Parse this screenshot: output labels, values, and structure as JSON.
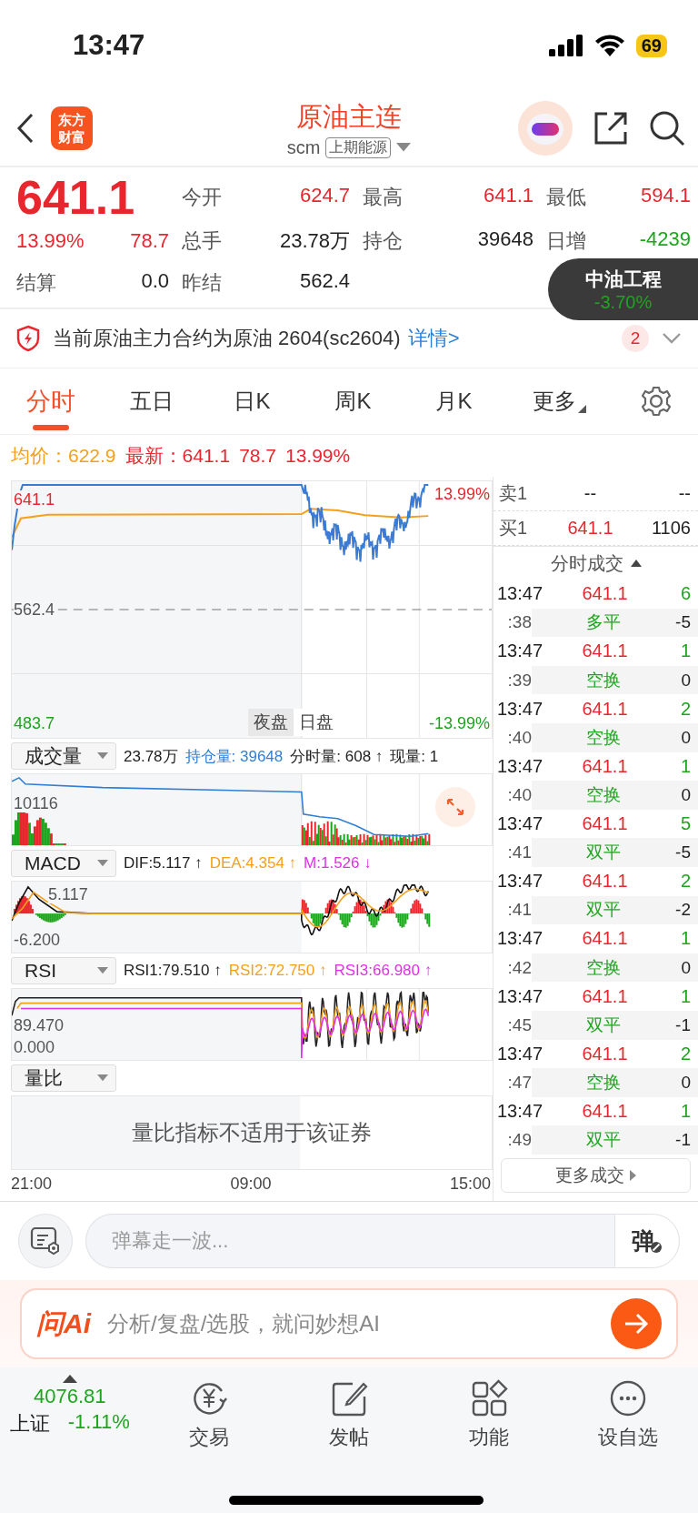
{
  "status_bar": {
    "time": "13:47",
    "battery": "69",
    "low_power": true
  },
  "header": {
    "logo_lines": [
      "东方",
      "财富"
    ],
    "title": "原油主连",
    "code": "scm",
    "exchange": "上期能源"
  },
  "quote": {
    "price": "641.1",
    "change_pct": "13.99%",
    "change": "78.7",
    "color": "#e8262d",
    "settlement": {
      "label": "结算",
      "value": "0.0"
    },
    "fields": [
      {
        "label": "今开",
        "value": "624.7",
        "color": "#e8262d"
      },
      {
        "label": "最高",
        "value": "641.1",
        "color": "#e8262d"
      },
      {
        "label": "最低",
        "value": "594.1",
        "color": "#e8262d"
      },
      {
        "label": "总手",
        "value": "23.78万",
        "color": "#222222"
      },
      {
        "label": "持仓",
        "value": "39648",
        "color": "#222222"
      },
      {
        "label": "日增",
        "value": "-4239",
        "color": "#1ea51e"
      },
      {
        "label": "昨结",
        "value": "562.4",
        "color": "#222222"
      }
    ]
  },
  "popup": {
    "name": "中油工程",
    "change": "-3.70%"
  },
  "notice": {
    "text": "当前原油主力合约为原油 2604(sc2604)",
    "link": "详情>",
    "badge": "2"
  },
  "tabs": [
    {
      "label": "分时",
      "selected": true
    },
    {
      "label": "五日",
      "selected": false
    },
    {
      "label": "日K",
      "selected": false
    },
    {
      "label": "周K",
      "selected": false
    },
    {
      "label": "月K",
      "selected": false
    },
    {
      "label": "更多",
      "selected": false
    }
  ],
  "summary": {
    "avg_label": "均价：",
    "avg": "622.9",
    "latest_label": "最新：",
    "latest": "641.1",
    "change": "78.7",
    "pct": "13.99%"
  },
  "price_chart": {
    "high": "641.1",
    "high_pct": "13.99%",
    "prev_close": "562.4",
    "low": "483.7",
    "low_pct": "-13.99%",
    "sessions": [
      {
        "label": "夜盘",
        "selected": true
      },
      {
        "label": "日盘",
        "selected": false
      }
    ]
  },
  "indicators": [
    {
      "kind": "volume",
      "name": "成交量",
      "readouts": [
        {
          "text": "23.78万",
          "color": "#222222"
        },
        {
          "text": "持仓量: 39648",
          "color": "#2f7fd6"
        },
        {
          "text": "分时量: 608 ↑",
          "color": "#222222"
        },
        {
          "text": "现量: 1",
          "color": "#222222"
        }
      ],
      "labels": [
        "10116"
      ]
    },
    {
      "kind": "macd",
      "name": "MACD",
      "readouts": [
        {
          "text": "DIF:5.117 ↑",
          "color": "#222222"
        },
        {
          "text": "DEA:4.354 ↑",
          "color": "#f5a01a"
        },
        {
          "text": "M:1.526 ↓",
          "color": "#e22fe6"
        }
      ],
      "labels": [
        "5.117",
        "-6.200"
      ]
    },
    {
      "kind": "rsi",
      "name": "RSI",
      "readouts": [
        {
          "text": "RSI1:79.510 ↑",
          "color": "#222222"
        },
        {
          "text": "RSI2:72.750 ↑",
          "color": "#f5a01a"
        },
        {
          "text": "RSI3:66.980 ↑",
          "color": "#e22fe6"
        }
      ],
      "labels": [
        "89.470",
        "0.000"
      ]
    },
    {
      "kind": "ratio",
      "name": "量比",
      "message": "量比指标不适用于该证券"
    }
  ],
  "time_axis": [
    "21:00",
    "09:00",
    "15:00"
  ],
  "order_book": [
    {
      "side": "卖1",
      "price": "--",
      "volume": "--",
      "color": "#222222"
    },
    {
      "side": "买1",
      "price": "641.1",
      "volume": "1106",
      "color": "#e8262d"
    }
  ],
  "trades_title": "分时成交",
  "trades": [
    {
      "time": "13:47",
      "price": "641.1",
      "volume": "6",
      "sec": ":38",
      "type": "多平",
      "change": "-5"
    },
    {
      "time": "13:47",
      "price": "641.1",
      "volume": "1",
      "sec": ":39",
      "type": "空换",
      "change": "0"
    },
    {
      "time": "13:47",
      "price": "641.1",
      "volume": "2",
      "sec": ":40",
      "type": "空换",
      "change": "0"
    },
    {
      "time": "13:47",
      "price": "641.1",
      "volume": "1",
      "sec": ":40",
      "type": "空换",
      "change": "0"
    },
    {
      "time": "13:47",
      "price": "641.1",
      "volume": "5",
      "sec": ":41",
      "type": "双平",
      "change": "-5"
    },
    {
      "time": "13:47",
      "price": "641.1",
      "volume": "2",
      "sec": ":41",
      "type": "双平",
      "change": "-2"
    },
    {
      "time": "13:47",
      "price": "641.1",
      "volume": "1",
      "sec": ":42",
      "type": "空换",
      "change": "0"
    },
    {
      "time": "13:47",
      "price": "641.1",
      "volume": "1",
      "sec": ":45",
      "type": "双平",
      "change": "-1"
    },
    {
      "time": "13:47",
      "price": "641.1",
      "volume": "2",
      "sec": ":47",
      "type": "空换",
      "change": "0"
    },
    {
      "time": "13:47",
      "price": "641.1",
      "volume": "1",
      "sec": ":49",
      "type": "双平",
      "change": "-1"
    }
  ],
  "more_trades": "更多成交",
  "danmaku": {
    "placeholder": "弹幕走一波...",
    "button": "弹"
  },
  "ai_bar": {
    "logo": "问Ai",
    "placeholder": "分析/复盘/选股，就问妙想AI"
  },
  "nav": {
    "index": {
      "value": "4076.81",
      "name": "上证",
      "change": "-1.11%"
    },
    "items": [
      {
        "label": "交易",
        "kind": "trade"
      },
      {
        "label": "发帖",
        "kind": "post"
      },
      {
        "label": "功能",
        "kind": "apps"
      },
      {
        "label": "设自选",
        "kind": "more"
      }
    ]
  }
}
